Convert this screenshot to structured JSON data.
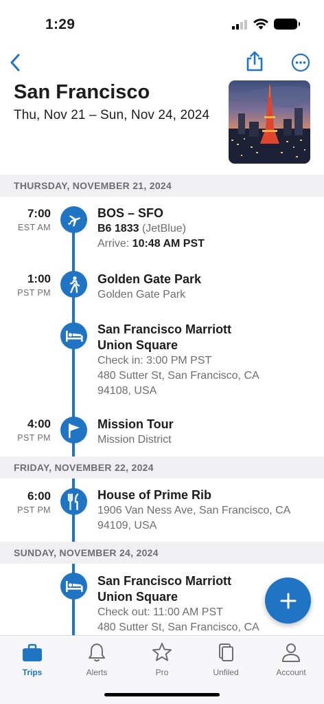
{
  "status_bar": {
    "time": "1:29"
  },
  "header": {
    "title": "San Francisco",
    "dates": "Thu, Nov 21 – Sun, Nov 24, 2024"
  },
  "days": [
    {
      "label": "THURSDAY, NOVEMBER 21, 2024",
      "items": [
        {
          "icon": "airplane-icon",
          "time": "7:00",
          "zone": "EST AM",
          "title": "BOS – SFO",
          "sub1_bold": "B6 1833",
          "sub1": " (JetBlue)",
          "sub2_prefix": "Arrive: ",
          "sub2_bold": "10:48 AM PST"
        },
        {
          "icon": "walking-person-icon",
          "time": "1:00",
          "zone": "PST PM",
          "title": "Golden Gate Park",
          "sub1": "Golden Gate Park"
        },
        {
          "icon": "bed-icon",
          "time": "",
          "zone": "",
          "title_line1": "San Francisco Marriott",
          "title_line2": "Union Square",
          "sub1": "Check in: 3:00 PM PST",
          "sub2": "480 Sutter St, San Francisco, CA",
          "sub3": "94108, USA"
        },
        {
          "icon": "flag-icon",
          "time": "4:00",
          "zone": "PST PM",
          "title": "Mission Tour",
          "sub1": "Mission District"
        }
      ]
    },
    {
      "label": "FRIDAY, NOVEMBER 22, 2024",
      "items": [
        {
          "icon": "fork-knife-icon",
          "time": "6:00",
          "zone": "PST PM",
          "title": "House of Prime Rib",
          "sub1": "1906 Van Ness Ave, San Francisco, CA",
          "sub2": "94109, USA"
        }
      ]
    },
    {
      "label": "SUNDAY, NOVEMBER 24, 2024",
      "items": [
        {
          "icon": "bed-icon",
          "time": "",
          "zone": "",
          "title_line1": "San Francisco Marriott",
          "title_line2": "Union Square",
          "sub1": "Check out: 11:00 AM PST",
          "sub2": "480 Sutter St, San Francisco, CA"
        }
      ]
    }
  ],
  "tabs": [
    {
      "label": "Trips",
      "icon": "suitcase-icon",
      "active": true
    },
    {
      "label": "Alerts",
      "icon": "bell-icon",
      "active": false
    },
    {
      "label": "Pro",
      "icon": "star-icon",
      "active": false
    },
    {
      "label": "Unfiled",
      "icon": "documents-icon",
      "active": false
    },
    {
      "label": "Account",
      "icon": "person-icon",
      "active": false
    }
  ],
  "colors": {
    "accent": "#1f74c3",
    "day_header_bg": "#f0f0f3",
    "secondary_text": "#6d6d72"
  }
}
